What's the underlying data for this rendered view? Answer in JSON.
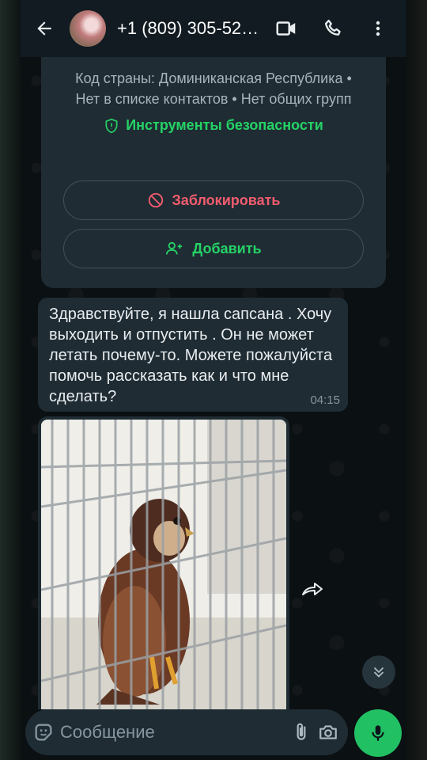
{
  "header": {
    "title": "+1 (809) 305-52…",
    "icons": [
      "back-arrow-icon",
      "video-call-icon",
      "phone-icon",
      "more-vertical-icon"
    ]
  },
  "info_card": {
    "description": "Код страны: Доминиканская Республика • Нет в списке контактов • Нет общих групп",
    "safety_tools": "Инструменты безопасности",
    "block_label": "Заблокировать",
    "add_label": "Добавить"
  },
  "message": {
    "text": "Здравствуйте, я нашла сапсана . Хочу выходить и отпустить . Он не может летать почему-то. Можете пожалуйста помочь рассказать как и что мне сделать?",
    "time": "04:15"
  },
  "composer": {
    "placeholder": "Сообщение"
  },
  "colors": {
    "accent": "#25d366",
    "danger": "#f15c6d",
    "bubble": "#1f2c34",
    "header": "#111b21"
  }
}
